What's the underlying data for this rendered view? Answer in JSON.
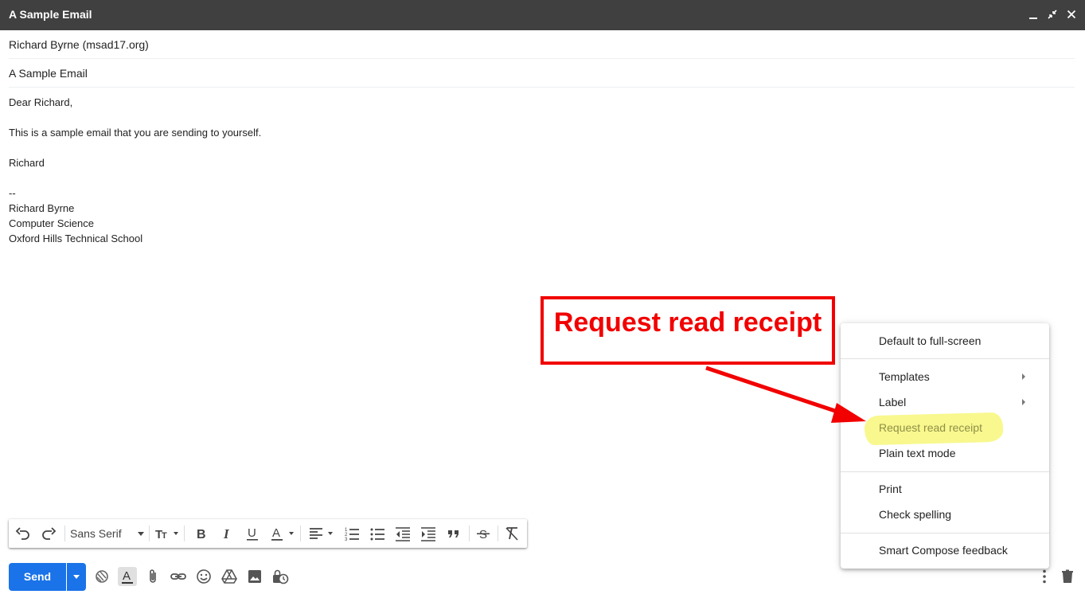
{
  "window": {
    "title": "A Sample Email",
    "minimize_icon": "minimize-icon",
    "fullscreen_icon": "exit-fullscreen-icon",
    "close_icon": "close-icon"
  },
  "compose": {
    "to": "Richard Byrne (msad17.org)",
    "subject": "A Sample Email",
    "body_lines": [
      "Dear Richard,",
      "",
      "This is a sample email that you are sending to yourself.",
      "",
      "Richard",
      "",
      "--",
      "Richard Byrne",
      "Computer Science",
      "Oxford Hills Technical School"
    ]
  },
  "formatting_toolbar": {
    "font": "Sans Serif",
    "buttons": [
      "undo-icon",
      "redo-icon",
      "font-family-select",
      "text-size-icon",
      "bold-icon",
      "italic-icon",
      "underline-icon",
      "text-color-icon",
      "align-icon",
      "numbered-list-icon",
      "bulleted-list-icon",
      "indent-less-icon",
      "indent-more-icon",
      "quote-icon",
      "strikethrough-icon",
      "remove-formatting-icon"
    ]
  },
  "bottom_toolbar": {
    "send_label": "Send",
    "icons": [
      "send-options-icon",
      "confidential-mode-icon",
      "formatting-options-icon",
      "attach-icon",
      "link-icon",
      "emoji-icon",
      "drive-icon",
      "photo-icon",
      "schedule-lock-icon",
      "more-options-icon",
      "discard-icon"
    ]
  },
  "more_options_menu": {
    "items": [
      {
        "label": "Default to full-screen"
      },
      {
        "label": "Templates",
        "submenu": true
      },
      {
        "label": "Label",
        "submenu": true
      },
      {
        "label": "Request read receipt",
        "highlighted": true
      },
      {
        "label": "Plain text mode"
      },
      {
        "label": "Print"
      },
      {
        "label": "Check spelling"
      },
      {
        "label": "Smart Compose feedback"
      }
    ]
  },
  "annotation": {
    "text": "Request read receipt",
    "color": "#f20000"
  },
  "colors": {
    "titlebar": "#404040",
    "send": "#1a73e8",
    "highlight": "#f7f77a"
  }
}
